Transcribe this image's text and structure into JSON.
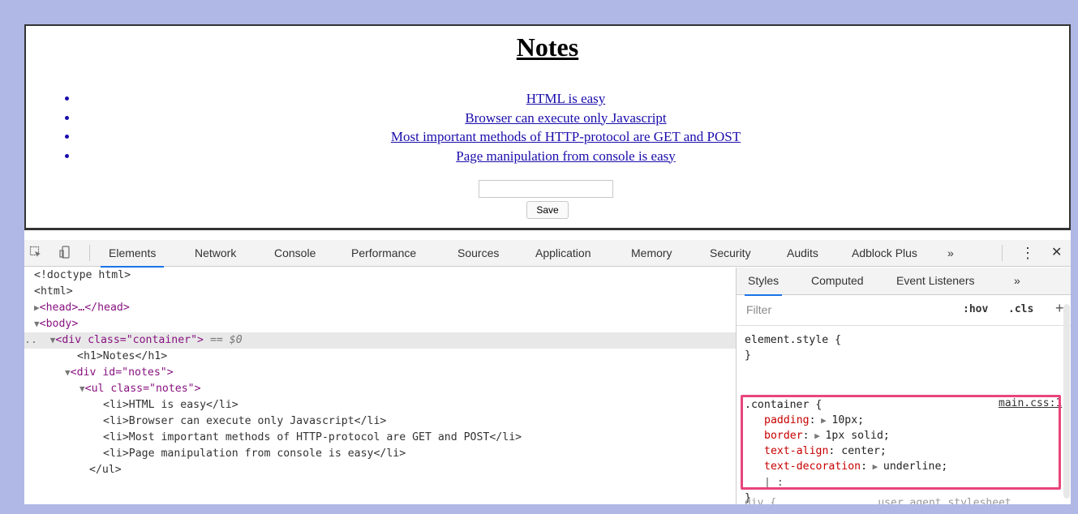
{
  "page": {
    "title": "Notes",
    "notes": [
      "HTML is easy",
      "Browser can execute only Javascript",
      "Most important methods of HTTP-protocol are GET and POST",
      "Page manipulation from console is easy"
    ],
    "save_label": "Save"
  },
  "devtools": {
    "tabs": [
      "Elements",
      "Network",
      "Console",
      "Performance",
      "Sources",
      "Application",
      "Memory",
      "Security",
      "Audits",
      "Adblock Plus"
    ],
    "more": "»",
    "menu": "⋮",
    "close": "✕",
    "dom": {
      "doctype": "<!doctype html>",
      "html": "<html>",
      "head": "<head>…</head>",
      "body": "<body>",
      "div_open": "<div class=\"container\">",
      "div_marker": " == $0",
      "h1": "<h1>Notes</h1>",
      "div_notes": "<div id=\"notes\">",
      "ul_notes": "<ul class=\"notes\">",
      "li_items": [
        "<li>HTML is easy</li>",
        "<li>Browser can execute only Javascript</li>",
        "<li>Most important methods of HTTP-protocol are GET and POST</li>",
        "<li>Page manipulation from console is easy</li>"
      ],
      "ul_close": "</ul>"
    },
    "styles_panel": {
      "subtabs": [
        "Styles",
        "Computed",
        "Event Listeners"
      ],
      "more": "»",
      "filter_placeholder": "Filter",
      "hov": ":hov",
      "cls": ".cls",
      "plus": "+",
      "element_style": "element.style {",
      "close_brace": "}",
      "rule_selector": ".container {",
      "rule_source": "main.css:1",
      "declarations": [
        {
          "prop": "padding",
          "value": "10px;",
          "expander": true
        },
        {
          "prop": "border",
          "value": "1px solid;",
          "expander": true
        },
        {
          "prop": "text-align",
          "value": "center;",
          "expander": false
        },
        {
          "prop": "text-decoration",
          "value": "underline;",
          "expander": true
        }
      ],
      "cursor_line": "| :",
      "next_rule": "div {                user agent stylesheet"
    }
  }
}
